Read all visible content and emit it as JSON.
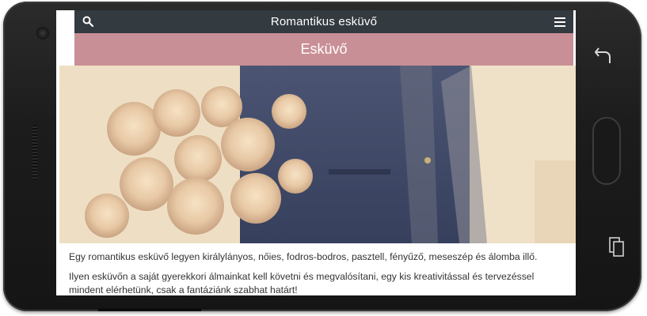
{
  "app": {
    "title": "Romantikus esküvő"
  },
  "section": {
    "title": "Esküvő"
  },
  "content": {
    "paragraph1": "Egy romantikus esküvő legyen királylányos, nőies, fodros-bodros, pasztell, fényűző, meseszép és álomba illő.",
    "paragraph2": "Ilyen esküvőn a saját gyerekkori álmainkat kell követni és megvalósítani, egy kis kreativitással és tervezéssel mindent elérhetünk, csak a fantáziánk szabhat határt!"
  },
  "icons": {
    "search": "search-icon",
    "menu": "hamburger-menu-icon",
    "back": "back-arrow-icon",
    "recent": "recent-apps-icon"
  },
  "colors": {
    "topbar": "#333a40",
    "band": "#c98f96"
  }
}
